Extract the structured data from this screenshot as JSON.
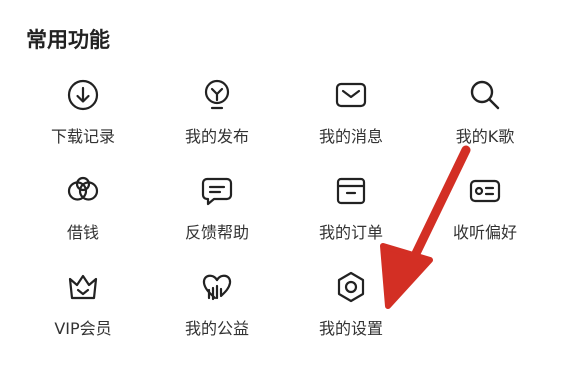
{
  "section": {
    "title": "常用功能"
  },
  "items": [
    {
      "label": "下载记录",
      "icon": "download-icon"
    },
    {
      "label": "我的发布",
      "icon": "lightbulb-icon"
    },
    {
      "label": "我的消息",
      "icon": "envelope-icon"
    },
    {
      "label": "我的K歌",
      "icon": "microphone-icon"
    },
    {
      "label": "借钱",
      "icon": "money-rings-icon"
    },
    {
      "label": "反馈帮助",
      "icon": "chat-bubble-icon"
    },
    {
      "label": "我的订单",
      "icon": "order-box-icon"
    },
    {
      "label": "收听偏好",
      "icon": "preference-card-icon"
    },
    {
      "label": "VIP会员",
      "icon": "crown-icon"
    },
    {
      "label": "我的公益",
      "icon": "charity-heart-icon"
    },
    {
      "label": "我的设置",
      "icon": "settings-hexagon-icon"
    }
  ],
  "annotation": {
    "color": "#d32f24",
    "icon": "red-arrow-icon"
  }
}
